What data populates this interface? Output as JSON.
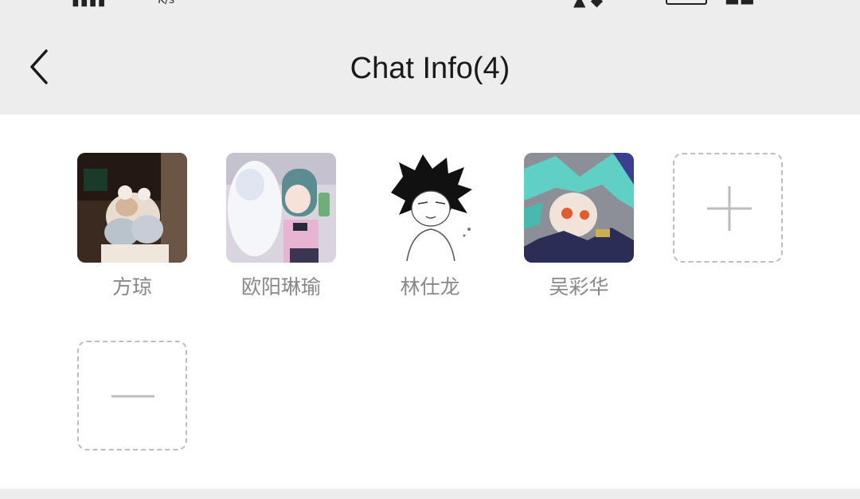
{
  "header": {
    "title": "Chat Info(4)",
    "back_icon": "chevron-left-icon"
  },
  "members": [
    {
      "name": "方琼",
      "avatar": "avatar-photo-girl"
    },
    {
      "name": "欧阳琳瑜",
      "avatar": "avatar-anime-girl-pink"
    },
    {
      "name": "林仕龙",
      "avatar": "avatar-sketch-boy"
    },
    {
      "name": "吴彩华",
      "avatar": "avatar-anime-teal-hair"
    }
  ],
  "actions": {
    "add_icon": "plus-icon",
    "remove_icon": "minus-icon"
  },
  "colors": {
    "background": "#ededed",
    "panel": "#ffffff",
    "name_text": "#888888",
    "dashed_border": "#bdbdbd"
  }
}
